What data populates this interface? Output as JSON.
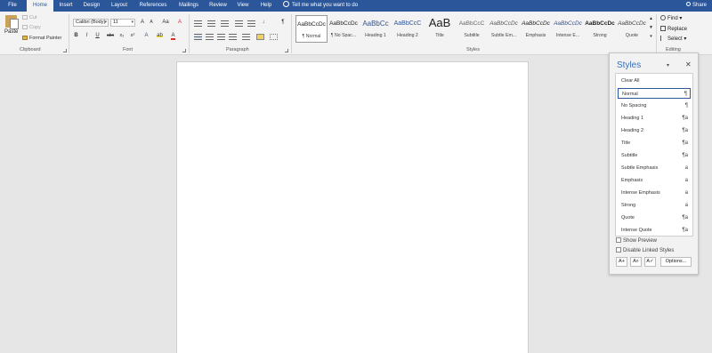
{
  "tabs": [
    "File",
    "Home",
    "Insert",
    "Design",
    "Layout",
    "References",
    "Mailings",
    "Review",
    "View",
    "Help"
  ],
  "active_tab": "Home",
  "tell_me": "Tell me what you want to do",
  "share": "Share",
  "clipboard": {
    "paste": "Paste",
    "cut": "Cut",
    "copy": "Copy",
    "format_painter": "Format Painter",
    "label": "Clipboard"
  },
  "font": {
    "name": "Calibri (Body)",
    "size": "11",
    "grow": "A",
    "shrink": "A",
    "change_case": "Aa",
    "bold": "B",
    "italic": "I",
    "underline": "U",
    "strike": "abc",
    "subscript": "x₂",
    "superscript": "x²",
    "font_color": "A",
    "label": "Font",
    "accent_highlight": "#f4e03c",
    "accent_font_color": "#d0312d"
  },
  "paragraph": {
    "label": "Paragraph",
    "pilcrow": "¶"
  },
  "styles_gallery": {
    "label": "Styles",
    "items": [
      {
        "sample": "AaBbCcDc",
        "caption": "¶ Normal"
      },
      {
        "sample": "AaBbCcDc",
        "caption": "¶ No Spac..."
      },
      {
        "sample": "AaBbCc",
        "caption": "Heading 1"
      },
      {
        "sample": "AaBbCcC",
        "caption": "Heading 2"
      },
      {
        "sample": "AaB",
        "caption": "Title"
      },
      {
        "sample": "AaBbCcC",
        "caption": "Subtitle"
      },
      {
        "sample": "AaBbCcDc",
        "caption": "Subtle Em..."
      },
      {
        "sample": "AaBbCcDc",
        "caption": "Emphasis"
      },
      {
        "sample": "AaBbCcDc",
        "caption": "Intense E..."
      },
      {
        "sample": "AaBbCcDc",
        "caption": "Strong"
      },
      {
        "sample": "AaBbCcDc",
        "caption": "Quote"
      }
    ]
  },
  "editing": {
    "find": "Find",
    "replace": "Replace",
    "select": "Select",
    "label": "Editing"
  },
  "styles_pane": {
    "title": "Styles",
    "items": [
      {
        "name": "Clear All",
        "indicator": ""
      },
      {
        "name": "Normal",
        "indicator": "¶"
      },
      {
        "name": "No Spacing",
        "indicator": "¶"
      },
      {
        "name": "Heading 1",
        "indicator": "¶a"
      },
      {
        "name": "Heading 2",
        "indicator": "¶a"
      },
      {
        "name": "Title",
        "indicator": "¶a"
      },
      {
        "name": "Subtitle",
        "indicator": "¶a"
      },
      {
        "name": "Subtle Emphasis",
        "indicator": "a"
      },
      {
        "name": "Emphasis",
        "indicator": "a"
      },
      {
        "name": "Intense Emphasis",
        "indicator": "a"
      },
      {
        "name": "Strong",
        "indicator": "a"
      },
      {
        "name": "Quote",
        "indicator": "¶a"
      },
      {
        "name": "Intense Quote",
        "indicator": "¶a"
      }
    ],
    "selected_index": 1,
    "show_preview": "Show Preview",
    "disable_linked": "Disable Linked Styles",
    "options": "Options..."
  },
  "colors": {
    "brand": "#2b579a",
    "pane_title": "#3a6fb6"
  }
}
